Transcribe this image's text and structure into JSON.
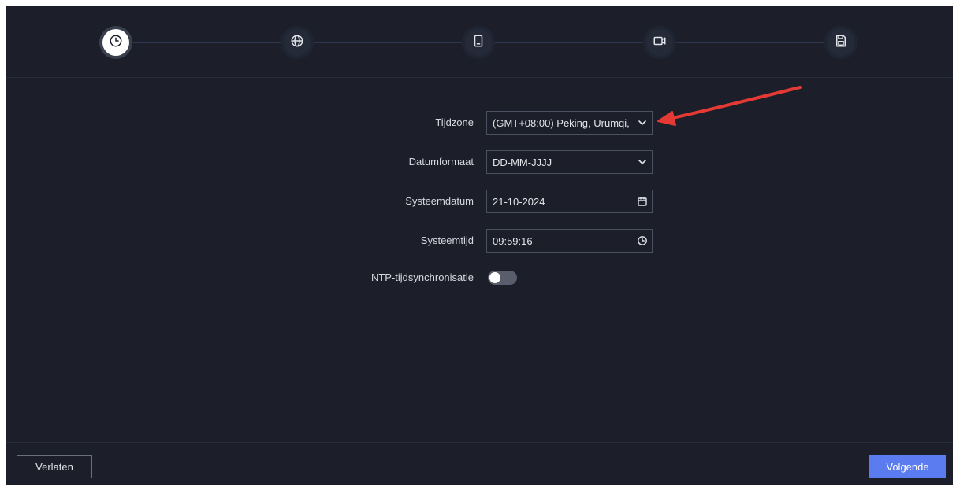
{
  "stepper": {
    "steps": [
      {
        "icon": "clock-icon",
        "active": true
      },
      {
        "icon": "globe-icon",
        "active": false
      },
      {
        "icon": "mobile-device-icon",
        "active": false
      },
      {
        "icon": "camera-icon",
        "active": false
      },
      {
        "icon": "save-disk-icon",
        "active": false
      }
    ]
  },
  "form": {
    "timezone": {
      "label": "Tijdzone",
      "value": "(GMT+08:00) Peking, Urumqi,"
    },
    "date_format": {
      "label": "Datumformaat",
      "value": "DD-MM-JJJJ"
    },
    "system_date": {
      "label": "Systeemdatum",
      "value": "21-10-2024"
    },
    "system_time": {
      "label": "Systeemtijd",
      "value": "09:59:16"
    },
    "ntp_sync": {
      "label": "NTP-tijdsynchronisatie",
      "enabled": false
    }
  },
  "footer": {
    "exit_label": "Verlaten",
    "next_label": "Volgende"
  },
  "colors": {
    "background": "#1c1f29",
    "accent": "#5b7cf0",
    "annotation_arrow": "#e53935"
  }
}
